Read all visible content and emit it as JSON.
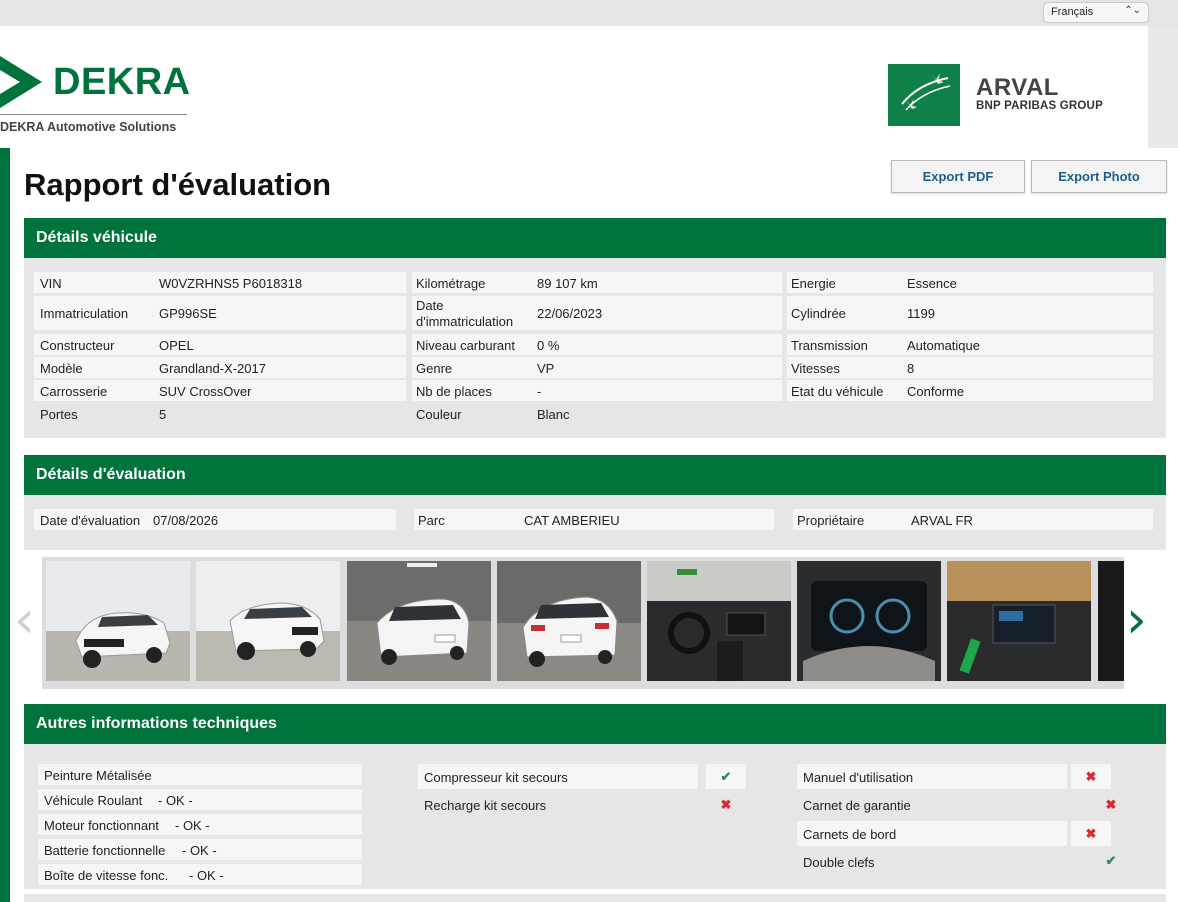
{
  "language_select": {
    "value": "Français"
  },
  "header": {
    "dekra_name": "DEKRA",
    "dekra_subtitle": "DEKRA Automotive Solutions",
    "arval_name": "ARVAL",
    "arval_subtitle": "BNP PARIBAS GROUP"
  },
  "page": {
    "title": "Rapport d'évaluation",
    "export_pdf": "Export PDF",
    "export_photo": "Export Photo"
  },
  "vehicle": {
    "section_title": "Détails véhicule",
    "col1": [
      {
        "k": "VIN",
        "v": "W0VZRHNS5 P6018318"
      },
      {
        "k": "Immatriculation",
        "v": "GP996SE"
      },
      {
        "k": "Constructeur",
        "v": "OPEL"
      },
      {
        "k": "Modèle",
        "v": "Grandland-X-2017"
      },
      {
        "k": "Carrosserie",
        "v": "SUV CrossOver"
      },
      {
        "k": "Portes",
        "v": "5"
      }
    ],
    "col2": [
      {
        "k": "Kilométrage",
        "v": "89 107 km"
      },
      {
        "k": "Date d'immatriculation",
        "k_line1": "Date",
        "k_line2": "d'immatriculation",
        "v": "22/06/2023"
      },
      {
        "k": "Niveau carburant",
        "v": "0 %"
      },
      {
        "k": "Genre",
        "v": "VP"
      },
      {
        "k": "Nb de places",
        "v": "-"
      },
      {
        "k": "Couleur",
        "v": "Blanc"
      }
    ],
    "col3": [
      {
        "k": "Energie",
        "v": "Essence"
      },
      {
        "k": "Cylindrée",
        "v": "1199"
      },
      {
        "k": "Transmission",
        "v": "Automatique"
      },
      {
        "k": "Vitesses",
        "v": "8"
      },
      {
        "k": "Etat du véhicule",
        "v": "Conforme"
      }
    ]
  },
  "evaluation": {
    "section_title": "Détails d'évaluation",
    "date_label": "Date d'évaluation",
    "date_value": "07/08/2026",
    "parc_label": "Parc",
    "parc_value": "CAT AMBERIEU",
    "owner_label": "Propriétaire",
    "owner_value": "ARVAL FR"
  },
  "gallery": {
    "prev_icon": "chevron-left-icon",
    "next_icon": "chevron-right-icon"
  },
  "tech": {
    "section_title": "Autres informations techniques",
    "left": [
      {
        "k": "Peinture Métalisée",
        "v": ""
      },
      {
        "k": "Véhicule Roulant",
        "v": "- OK -"
      },
      {
        "k": "Moteur fonctionnant",
        "v": "- OK -"
      },
      {
        "k": "Batterie fonctionnelle",
        "v": "- OK -"
      },
      {
        "k": "Boîte de vitesse fonc.",
        "v": "- OK -"
      }
    ],
    "middle": [
      {
        "k": "Compresseur kit secours",
        "status": "check"
      },
      {
        "k": "Recharge kit secours",
        "status": "cross"
      }
    ],
    "right": [
      {
        "k": "Manuel d'utilisation",
        "status": "cross"
      },
      {
        "k": "Carnet de garantie",
        "status": "cross"
      },
      {
        "k": "Carnets de bord",
        "status": "cross"
      },
      {
        "k": "Double clefs",
        "status": "check"
      }
    ],
    "check_glyph": "✔",
    "cross_glyph": "✖"
  },
  "colors": {
    "brand_green": "#00733d",
    "link_blue": "#1c5e8a",
    "check_green": "#2e8b57",
    "cross_red": "#d9282f"
  }
}
